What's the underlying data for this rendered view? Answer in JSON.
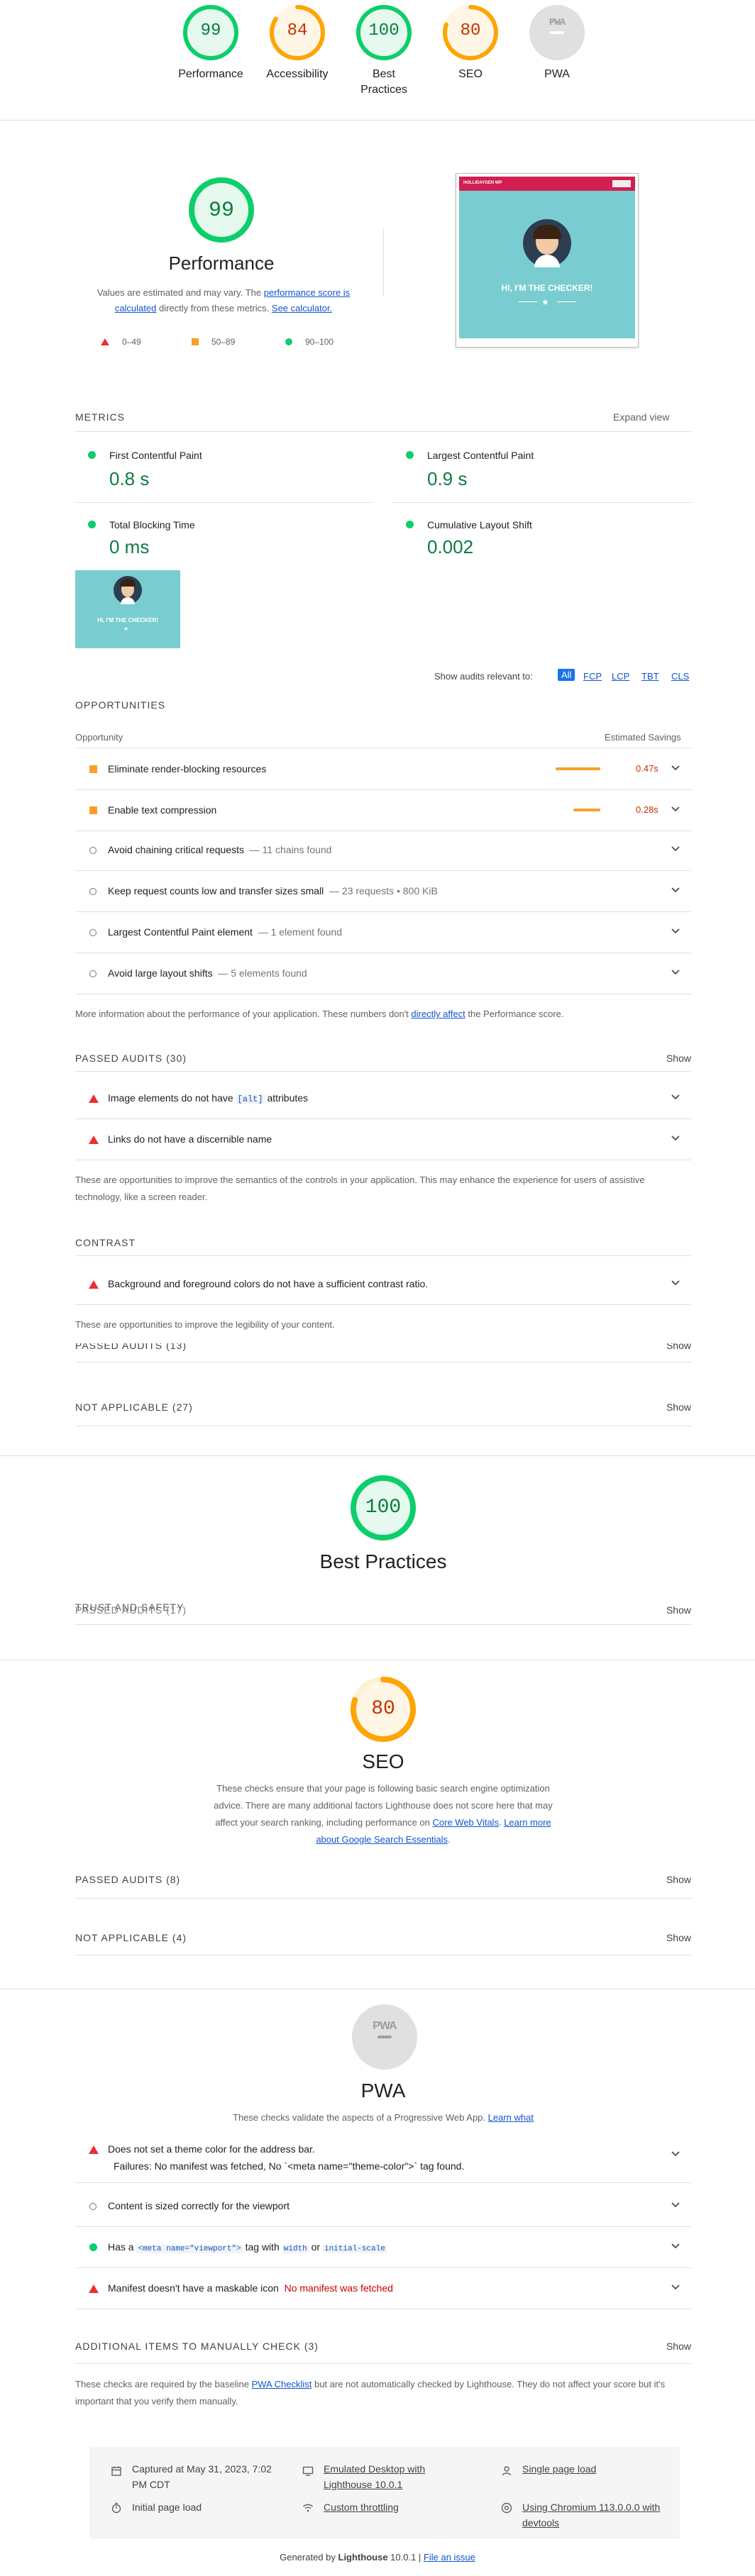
{
  "colors": {
    "pass": "#0cce6b",
    "average": "#ffa400",
    "fail": "#ff4e42",
    "link": "#1155cc"
  },
  "top_scores": [
    {
      "label": "Performance",
      "value": "99",
      "status": "pass",
      "fraction": 0.99
    },
    {
      "label": "Accessibility",
      "value": "84",
      "status": "average",
      "fraction": 0.84
    },
    {
      "label": "Best Practices",
      "value": "100",
      "status": "pass",
      "fraction": 1.0
    },
    {
      "label": "SEO",
      "value": "80",
      "status": "average",
      "fraction": 0.8
    },
    {
      "label": "PWA",
      "value": "PWA",
      "status": "na",
      "fraction": 0
    }
  ],
  "performance": {
    "score": "99",
    "title": "Performance",
    "desc_pre": "Values are estimated and may vary. The ",
    "desc_link1": "performance score is calculated",
    "desc_mid": " directly from these metrics. ",
    "desc_link2": "See calculator.",
    "legend": [
      "0–49",
      "50–89",
      "90–100"
    ],
    "screenshot": {
      "banner": "HOLLIDAYGEN WP",
      "headline": "HI, I'M THE CHECKER!"
    }
  },
  "metrics": {
    "heading": "METRICS",
    "expand": "Expand view",
    "items": [
      {
        "label": "First Contentful Paint",
        "value": "0.8 s"
      },
      {
        "label": "Largest Contentful Paint",
        "value": "0.9 s"
      },
      {
        "label": "Total Blocking Time",
        "value": "0 ms"
      },
      {
        "label": "Cumulative Layout Shift",
        "value": "0.002"
      }
    ],
    "thumb_caption": "HI, I'M THE CHECKER!"
  },
  "audit_filter": {
    "label": "Show audits relevant to:",
    "chips": [
      "All",
      "FCP",
      "LCP",
      "TBT",
      "CLS"
    ]
  },
  "opportunities": {
    "heading": "OPPORTUNITIES",
    "col_left": "Opportunity",
    "col_right": "Estimated Savings",
    "items": [
      {
        "text": "Eliminate render-blocking resources",
        "savings": "0.47s",
        "bar": 0.47
      },
      {
        "text": "Enable text compression",
        "savings": "0.28s",
        "bar": 0.28
      }
    ]
  },
  "diagnostics": [
    {
      "text": "Avoid chaining critical requests",
      "sub": "— 11 chains found"
    },
    {
      "text": "Keep request counts low and transfer sizes small",
      "sub": "— 23 requests • 800 KiB"
    },
    {
      "text": "Largest Contentful Paint element",
      "sub": "— 1 element found"
    },
    {
      "text": "Avoid large layout shifts",
      "sub": "— 5 elements found"
    }
  ],
  "perf_note": {
    "pre": "More information about the performance of your application. These numbers don't ",
    "link": "directly affect",
    "post": " the Performance score."
  },
  "passed_audits_30": {
    "heading": "PASSED AUDITS (30)",
    "show": "Show"
  },
  "a11y_names": {
    "items": [
      {
        "pre": "Image elements do not have ",
        "code": "[alt]",
        "post": " attributes"
      },
      {
        "pre": "Links do not have a discernible name",
        "code": "",
        "post": ""
      }
    ],
    "note": "These are opportunities to improve the semantics of the controls in your application. This may enhance the experience for users of assistive technology, like a screen reader."
  },
  "contrast": {
    "heading": "CONTRAST",
    "item": "Background and foreground colors do not have a sufficient contrast ratio.",
    "note": "These are opportunities to improve the legibility of your content."
  },
  "passed_audits_13": {
    "heading": "PASSED AUDITS (13)",
    "show": "Show"
  },
  "not_applicable_27": {
    "heading": "NOT APPLICABLE (27)",
    "show": "Show"
  },
  "best_practices": {
    "score": "100",
    "title": "Best Practices",
    "overlap_a": "TRUST AND SAFETY",
    "overlap_b": "PASSED AUDITS (17)",
    "show": "Show"
  },
  "seo": {
    "score": "80",
    "title": "SEO",
    "desc": "These checks ensure that your page is following basic search engine optimization advice. There are many additional factors Lighthouse does not score here that may affect your search ranking, including performance on",
    "link1": "Core Web Vitals",
    "link2": "Learn more about Google Search Essentials",
    "passed": "PASSED AUDITS (8)",
    "na": "NOT APPLICABLE (4)",
    "show": "Show"
  },
  "pwa": {
    "badge": "PWA",
    "title": "PWA",
    "desc": "These checks validate the aspects of a Progressive Web App.",
    "learn": "Learn what",
    "items": [
      {
        "type": "fail",
        "text": "Does not set a theme color for the address bar.",
        "detail": "Failures: No manifest was fetched, No `<meta name=\"theme-color\">` tag found."
      },
      {
        "type": "info",
        "text": "Content is sized correctly for the viewport"
      },
      {
        "type": "pass",
        "pre": "Has a ",
        "code1": "<meta name=\"viewport\">",
        "mid": " tag with ",
        "code2": "width",
        "or": " or ",
        "code3": "initial-scale"
      },
      {
        "type": "fail",
        "text": "Manifest doesn't have a maskable icon",
        "detail": "No manifest was fetched"
      }
    ],
    "manual": "ADDITIONAL ITEMS TO MANUALLY CHECK (3)",
    "show": "Show",
    "note_pre": "These checks are required by the baseline ",
    "note_link": "PWA Checklist",
    "note_post": " but are not automatically checked by Lighthouse. They do not affect your score but it's important that you verify them manually."
  },
  "footer": {
    "captured": "Captured at May 31, 2023, 7:02 PM CDT",
    "emulated": "Emulated Desktop with Lighthouse 10.0.1",
    "single": "Single page load",
    "initial": "Initial page load",
    "throttling": "Custom throttling",
    "chromium": "Using Chromium 113.0.0.0 with devtools",
    "generated_pre": "Generated by ",
    "generated_brand": "Lighthouse",
    "generated_ver": " 10.0.1 | ",
    "issue": "File an issue"
  }
}
